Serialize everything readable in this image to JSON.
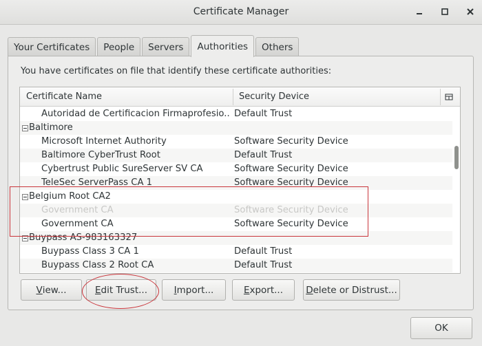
{
  "window": {
    "title": "Certificate Manager",
    "controls": [
      "minimize",
      "maximize",
      "close"
    ]
  },
  "tabs": [
    {
      "label": "Your Certificates",
      "active": false
    },
    {
      "label": "People",
      "active": false
    },
    {
      "label": "Servers",
      "active": false
    },
    {
      "label": "Authorities",
      "active": true
    },
    {
      "label": "Others",
      "active": false
    }
  ],
  "intro_text": "You have certificates on file that identify these certificate authorities:",
  "table": {
    "columns": [
      "Certificate Name",
      "Security Device"
    ],
    "column_picker_icon": "column-picker-icon",
    "rows": [
      {
        "type": "item",
        "name": "Autoridad de Certificacion Firmaprofesio...",
        "device": "Default Trust"
      },
      {
        "type": "group",
        "name": "Baltimore",
        "device": ""
      },
      {
        "type": "item",
        "name": "Microsoft Internet Authority",
        "device": "Software Security Device"
      },
      {
        "type": "item",
        "name": "Baltimore CyberTrust Root",
        "device": "Default Trust"
      },
      {
        "type": "item",
        "name": "Cybertrust Public SureServer SV CA",
        "device": "Software Security Device"
      },
      {
        "type": "item",
        "name": "TeleSec ServerPass CA 1",
        "device": "Software Security Device"
      },
      {
        "type": "group",
        "name": "Belgium Root CA2",
        "device": ""
      },
      {
        "type": "item",
        "name": "Government CA",
        "device": "Software Security Device",
        "faded": true
      },
      {
        "type": "item",
        "name": "Government CA",
        "device": "Software Security Device"
      },
      {
        "type": "group",
        "name": "Buypass AS-983163327",
        "device": ""
      },
      {
        "type": "item",
        "name": "Buypass Class 3 CA 1",
        "device": "Default Trust"
      },
      {
        "type": "item",
        "name": "Buypass Class 2 Root CA",
        "device": "Default Trust"
      }
    ]
  },
  "buttons": {
    "view": {
      "underlined": "V",
      "rest": "iew..."
    },
    "edit_trust": {
      "underlined": "E",
      "rest": "dit Trust..."
    },
    "import": {
      "underlined": "I",
      "rest": "mport..."
    },
    "export": {
      "underlined": "E",
      "rest": "xport..."
    },
    "delete": {
      "underlined": "D",
      "rest": "elete or Distrust..."
    },
    "ok": "OK"
  },
  "annotation_color": "#c9343a"
}
